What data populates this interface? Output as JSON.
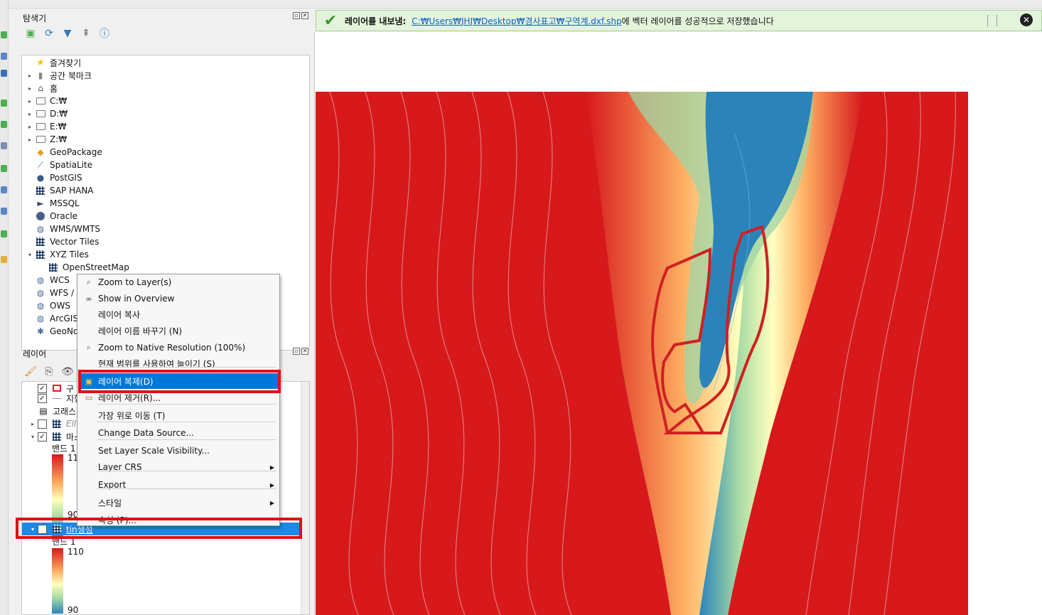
{
  "browser_panel": {
    "title": "탐색기",
    "items": [
      {
        "label": "즐겨찾기",
        "icon": "star-icon",
        "expand": ""
      },
      {
        "label": "공간 북마크",
        "icon": "bookmark-icon",
        "expand": "▸"
      },
      {
        "label": "홈",
        "icon": "home-icon",
        "expand": "▸"
      },
      {
        "label": "C:₩",
        "icon": "folder-icon",
        "expand": "▸"
      },
      {
        "label": "D:₩",
        "icon": "folder-icon",
        "expand": "▸"
      },
      {
        "label": "E:₩",
        "icon": "folder-icon",
        "expand": "▸"
      },
      {
        "label": "Z:₩",
        "icon": "folder-icon",
        "expand": "▸"
      },
      {
        "label": "GeoPackage",
        "icon": "geopackage-icon",
        "expand": ""
      },
      {
        "label": "SpatiaLite",
        "icon": "feather-icon",
        "expand": ""
      },
      {
        "label": "PostGIS",
        "icon": "elephant-icon",
        "expand": ""
      },
      {
        "label": "SAP HANA",
        "icon": "grid-icon",
        "expand": ""
      },
      {
        "label": "MSSQL",
        "icon": "mssql-icon",
        "expand": ""
      },
      {
        "label": "Oracle",
        "icon": "oracle-icon",
        "expand": ""
      },
      {
        "label": "WMS/WMTS",
        "icon": "globe-icon",
        "expand": ""
      },
      {
        "label": "Vector Tiles",
        "icon": "grid-icon",
        "expand": ""
      },
      {
        "label": "XYZ Tiles",
        "icon": "grid-icon",
        "expand": "▾"
      },
      {
        "label": "OpenStreetMap",
        "icon": "grid-icon",
        "expand": ""
      },
      {
        "label": "WCS",
        "icon": "globe-icon",
        "expand": ""
      },
      {
        "label": "WFS / O",
        "icon": "globe-icon",
        "expand": ""
      },
      {
        "label": "OWS",
        "icon": "globe-icon",
        "expand": ""
      },
      {
        "label": "ArcGIS",
        "icon": "globe-icon",
        "expand": ""
      },
      {
        "label": "GeoNo",
        "icon": "geonode-icon",
        "expand": ""
      }
    ]
  },
  "layers_panel": {
    "title": "레이어",
    "rows": [
      {
        "label": "구",
        "checked": true
      },
      {
        "label": "지형",
        "checked": true
      },
      {
        "label": "고래스",
        "checked": null
      },
      {
        "label": "Ell",
        "checked": false
      },
      {
        "label": "마스",
        "checked": true
      },
      {
        "label": "밴드 1",
        "checked": null
      }
    ],
    "legend1": {
      "max": "110",
      "min": "90"
    },
    "selected_layer": "tin생성",
    "legend2": {
      "band": "밴드 1",
      "max": "110",
      "min": "90"
    }
  },
  "message": {
    "title": "레이어를 내보냄:",
    "path": "C:₩Users₩JHJ₩Desktop₩경사표고₩구역계.dxf.shp",
    "tail": "에 벡터 레이어를 성공적으로 저장했습니다",
    "close": "✕"
  },
  "context_menu": {
    "items": [
      {
        "label": "Zoom to Layer(s)",
        "icon": "zoom-layer-icon"
      },
      {
        "label": "Show in Overview",
        "icon": "overview-icon"
      },
      {
        "label": "레이어 복사",
        "icon": ""
      },
      {
        "label": "레이어 이름 바꾸기 (N)",
        "icon": ""
      },
      {
        "label": "Zoom to Native Resolution (100%)",
        "icon": "zoom-native-icon"
      },
      {
        "label": "현재 범위를 사용하여 늘이기 (S)",
        "icon": ""
      },
      {
        "label": "레이어 복제(D)",
        "icon": "duplicate-icon",
        "selected": true
      },
      {
        "label": "레이어 제거(R)...",
        "icon": "remove-layer-icon"
      },
      {
        "label": "가장 위로 이동 (T)",
        "icon": ""
      },
      {
        "label": "Change Data Source...",
        "icon": ""
      },
      {
        "label": "Set Layer Scale Visibility...",
        "icon": ""
      },
      {
        "label": "Layer CRS",
        "icon": "",
        "submenu": true
      },
      {
        "label": "Export",
        "icon": "",
        "submenu": true
      },
      {
        "label": "스타일",
        "icon": "",
        "submenu": true
      },
      {
        "label": "속성 (P)...",
        "icon": ""
      }
    ]
  },
  "colors": {
    "ramp_high": "#d7191c",
    "ramp_mid": "#ffffbf",
    "ramp_low": "#2b83ba",
    "highlight": "#e01010",
    "selection": "#0078d7"
  }
}
